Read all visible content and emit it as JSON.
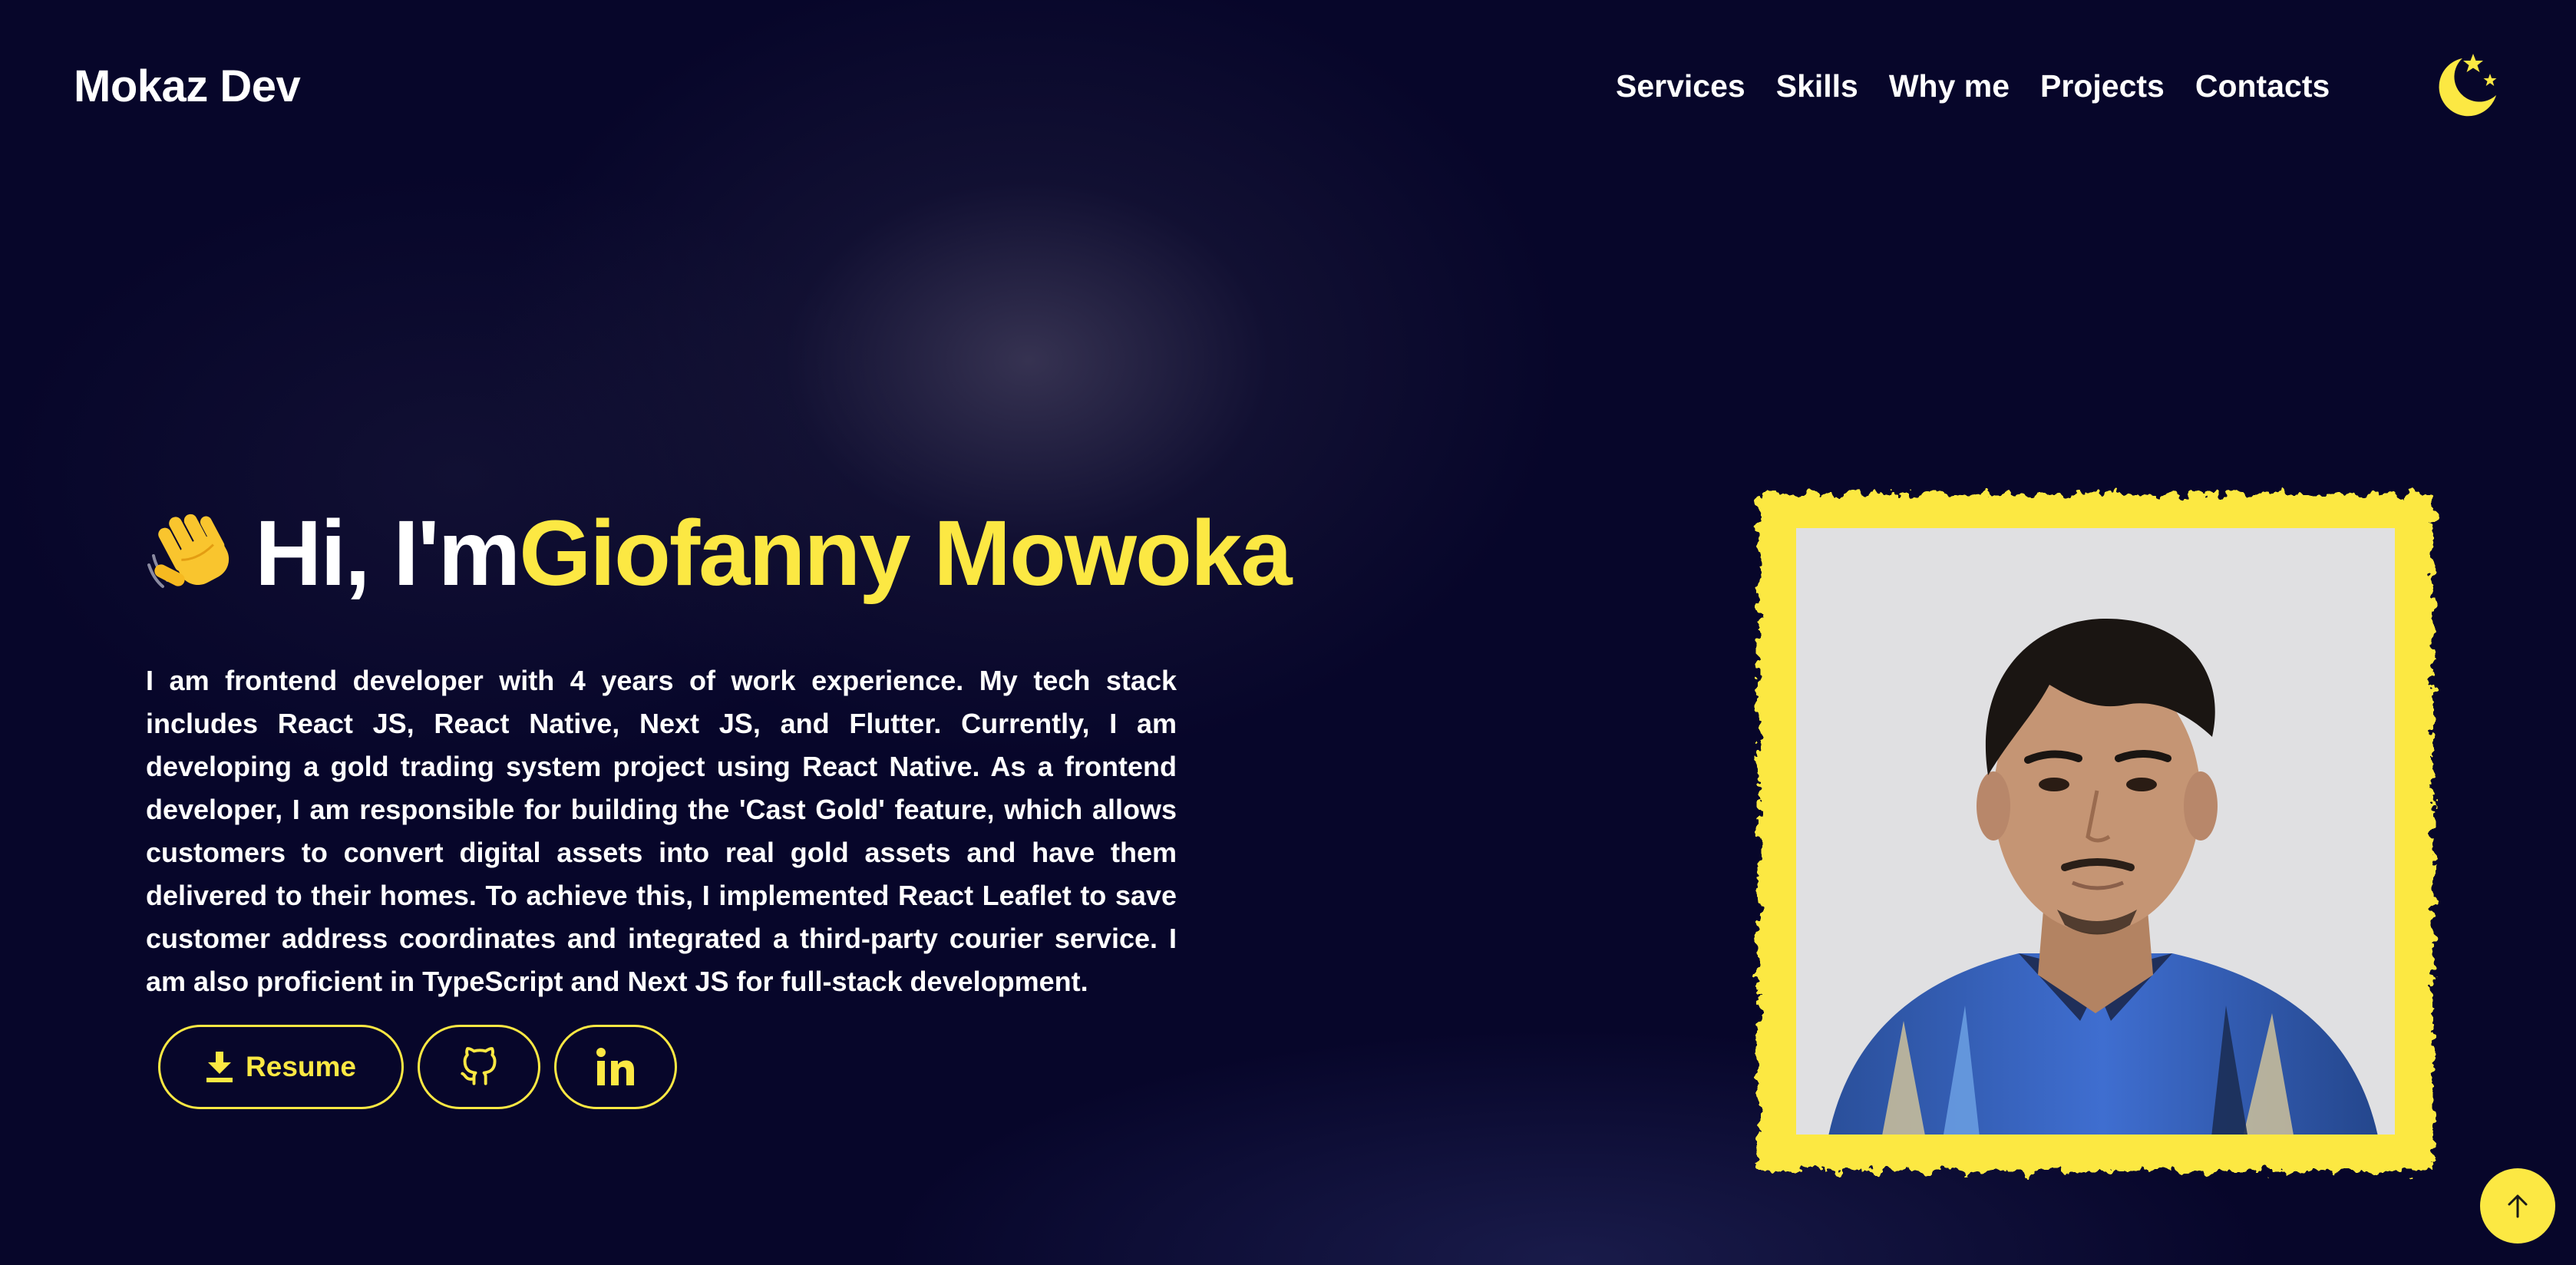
{
  "header": {
    "logo": "Mokaz Dev",
    "nav": [
      "Services",
      "Skills",
      "Why me",
      "Projects",
      "Contacts"
    ],
    "theme_toggle_icon": "moon-stars-icon"
  },
  "hero": {
    "wave_icon": "waving-hand-icon",
    "greeting": "Hi, I'm ",
    "name": "Giofanny Mowoka",
    "bio": "I am frontend developer with 4 years of work experience. My tech stack includes React JS, React Native, Next JS, and Flutter. Currently, I am developing a gold trading system project using React Native. As a frontend developer, I am responsible for building the 'Cast Gold' feature, which allows customers to convert digital assets into real gold assets and have them delivered to their homes. To achieve this, I implemented React Leaflet to save customer address coordinates and integrated a third-party courier service. I am also proficient in TypeScript and Next JS for full-stack development.",
    "buttons": {
      "resume": "Resume",
      "resume_icon": "download-icon",
      "github_icon": "github-icon",
      "linkedin_icon": "linkedin-icon"
    }
  },
  "portrait": {
    "image": "profile-photo",
    "frame": "yellow-brush-frame"
  },
  "scroll_top_icon": "arrow-up-icon",
  "colors": {
    "background": "#07062a",
    "accent": "#fce843",
    "text": "#ffffff"
  }
}
